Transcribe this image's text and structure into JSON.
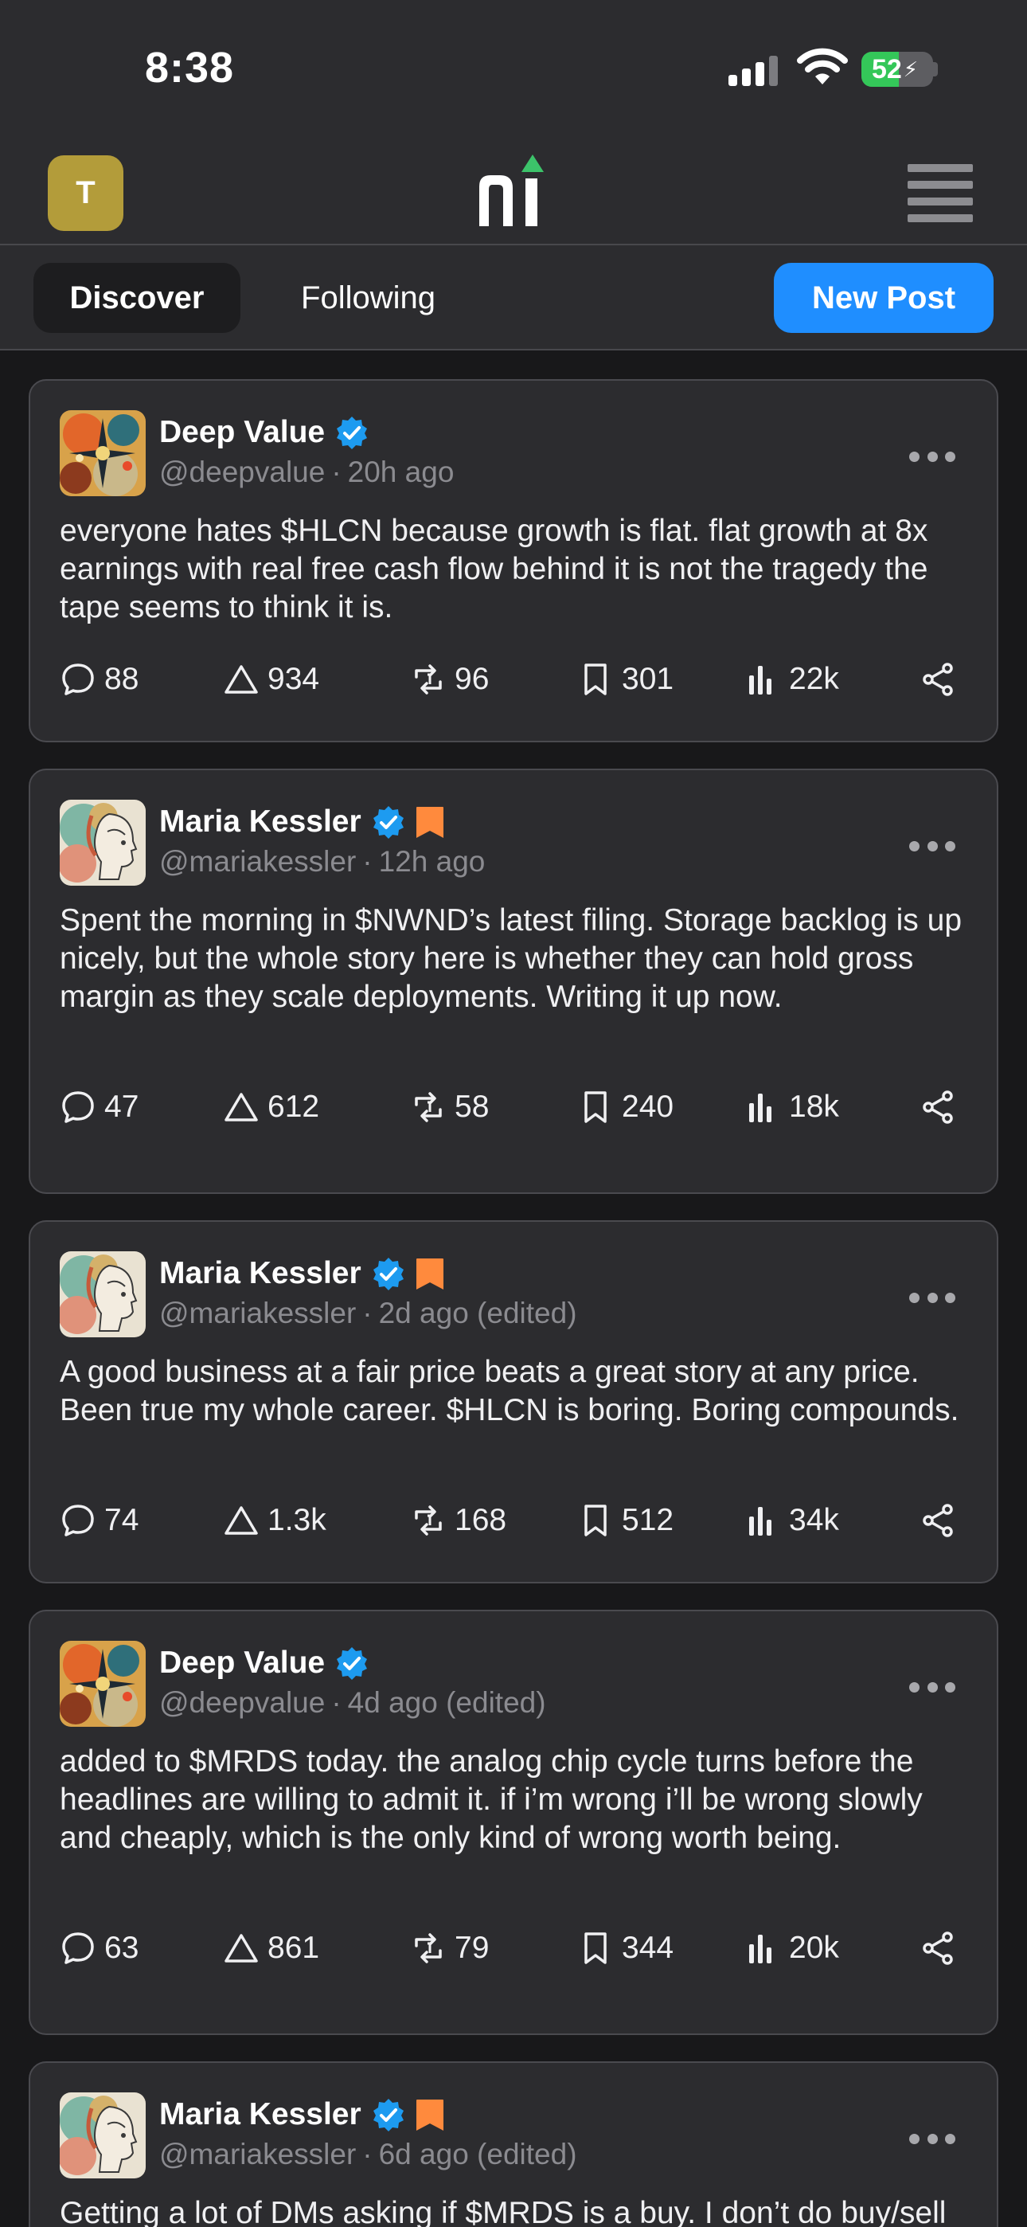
{
  "status_bar": {
    "time": "8:38",
    "battery": "52",
    "battery_level": 0.52
  },
  "header": {
    "avatar_letter": "T",
    "logo_icon": "ni-logo"
  },
  "tabs": {
    "discover": "Discover",
    "following": "Following",
    "new_post": "New Post"
  },
  "colors": {
    "accent": "#1f8eff",
    "verified": "#1d9bf0",
    "badge": "#ff8a3d",
    "logo_arrow": "#3cc36a"
  },
  "posts": [
    {
      "author": "Deep Value",
      "handle": "@deepvalue",
      "time": "20h ago",
      "badge": false,
      "text": "everyone hates $HLCN because growth is flat. flat growth at 8x earnings with real free cash flow behind it is not the tragedy the tape seems to think it is.",
      "comments": "88",
      "likes": "934",
      "reposts": "96",
      "saves": "301",
      "views": "22k"
    },
    {
      "author": "Maria Kessler",
      "handle": "@mariakessler",
      "time": "12h ago",
      "badge": true,
      "text": "Spent the morning in $NWND’s latest filing. Storage backlog is up nicely, but the whole story here is whether they can hold gross margin as they scale deployments. Writing it up now.",
      "comments": "47",
      "likes": "612",
      "reposts": "58",
      "saves": "240",
      "views": "18k"
    },
    {
      "author": "Maria Kessler",
      "handle": "@mariakessler",
      "time": "2d ago (edited)",
      "badge": true,
      "text": "A good business at a fair price beats a great story at any price. Been true my whole career. $HLCN is boring. Boring compounds.",
      "comments": "74",
      "likes": "1.3k",
      "reposts": "168",
      "saves": "512",
      "views": "34k"
    },
    {
      "author": "Deep Value",
      "handle": "@deepvalue",
      "time": "4d ago (edited)",
      "badge": false,
      "text": "added to $MRDS today. the analog chip cycle turns before the headlines are willing to admit it. if i’m wrong i’ll be wrong slowly and cheaply, which is the only kind of wrong worth being.",
      "comments": "63",
      "likes": "861",
      "reposts": "79",
      "saves": "344",
      "views": "20k"
    },
    {
      "author": "Maria Kessler",
      "handle": "@mariakessler",
      "time": "6d ago (edited)",
      "badge": true,
      "text": "Getting a lot of DMs asking if $MRDS is a buy. I don’t do buy/sell calls. I do the work and show it. The analog cycle"
    }
  ]
}
